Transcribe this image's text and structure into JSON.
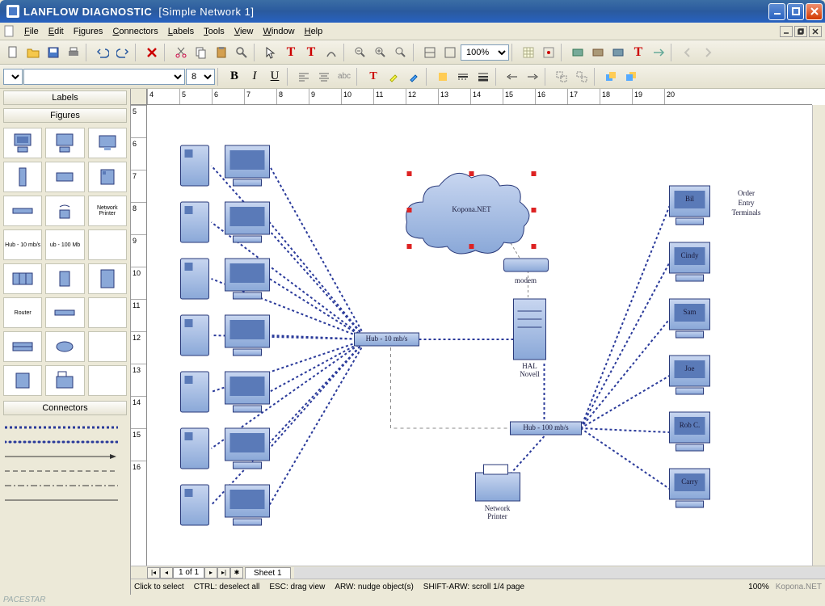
{
  "window": {
    "app_name": "LANFLOW DIAGNOSTIC",
    "document": "[Simple Network 1]"
  },
  "menubar": {
    "file": "File",
    "edit": "Edit",
    "figures": "Figures",
    "connectors": "Connectors",
    "labels": "Labels",
    "tools": "Tools",
    "view": "View",
    "window": "Window",
    "help": "Help"
  },
  "toolbar1": {
    "zoom_value": "100%"
  },
  "toolbar2": {
    "font_size": "8",
    "abc_label": "abc"
  },
  "sidepanel": {
    "labels_header": "Labels",
    "figures_header": "Figures",
    "connectors_header": "Connectors",
    "fig_hub10": "Hub - 10 mb/s",
    "fig_hub100": "ub - 100 Mb",
    "fig_netprn": "Network Printer",
    "fig_router": "Router"
  },
  "diagram": {
    "cloud_label": "Kopona.NET",
    "modem_label": "modem",
    "hub10_label": "Hub - 10 mb/s",
    "hub100_label": "Hub - 100 mb/s",
    "server_label1": "HAL",
    "server_label2": "Novell",
    "printer_label1": "Network",
    "printer_label2": "Printer",
    "terminals_label1": "Order",
    "terminals_label2": "Entry",
    "terminals_label3": "Terminals",
    "terminals": [
      "Bil",
      "Cindy",
      "Sam",
      "Joe",
      "Rob C.",
      "Carry"
    ]
  },
  "ruler_h": [
    "4",
    "5",
    "6",
    "7",
    "8",
    "9",
    "10",
    "11",
    "12",
    "13",
    "14",
    "15",
    "16",
    "17",
    "18",
    "19",
    "20"
  ],
  "ruler_v": [
    "5",
    "6",
    "7",
    "8",
    "9",
    "10",
    "11",
    "12",
    "13",
    "14",
    "15",
    "16"
  ],
  "footer": {
    "page_indicator": "1 of 1",
    "sheet_tab": "Sheet 1"
  },
  "status": {
    "hint_click": "Click to select",
    "hint_ctrl": "CTRL: deselect all",
    "hint_esc": "ESC: drag view",
    "hint_arw": "ARW: nudge object(s)",
    "hint_shift": "SHIFT-ARW: scroll 1/4 page",
    "zoom": "100%"
  },
  "watermark_left": "PACESTAR",
  "watermark_right": "Kopona.NET"
}
